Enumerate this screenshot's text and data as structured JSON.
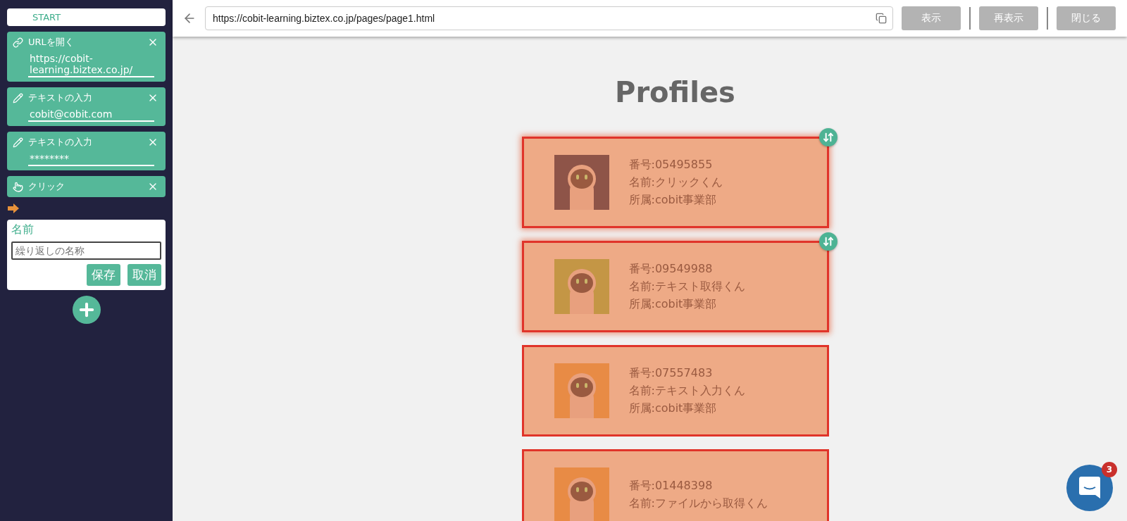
{
  "sidebar": {
    "start": "START",
    "steps": [
      {
        "kind": "url",
        "title": "URLを開く",
        "value": "https://cobit-learning.biztex.co.jp/"
      },
      {
        "kind": "text",
        "title": "テキストの入力",
        "value": "cobit@cobit.com"
      },
      {
        "kind": "text",
        "title": "テキストの入力",
        "value": "********"
      },
      {
        "kind": "click",
        "title": "クリック"
      }
    ],
    "form": {
      "label": "名前",
      "placeholder": "繰り返しの名称",
      "buttons": [
        "保存",
        "取消"
      ]
    }
  },
  "toolbar": {
    "url": "https://cobit-learning.biztex.co.jp/pages/page1.html",
    "buttons": [
      "表示",
      "再表示",
      "閉じる"
    ]
  },
  "page": {
    "title": "Profiles",
    "cards": [
      {
        "selected": true,
        "color": "#8e5448",
        "lines": [
          "番号:05495855",
          "名前:クリックくん",
          "所属:cobit事業部"
        ]
      },
      {
        "selected": true,
        "color": "#c49645",
        "lines": [
          "番号:09549988",
          "名前:テキスト取得くん",
          "所属:cobit事業部"
        ]
      },
      {
        "selected": false,
        "color": "#e88b45",
        "lines": [
          "番号:07557483",
          "名前:テキスト入力くん",
          "所属:cobit事業部"
        ]
      },
      {
        "selected": false,
        "color": "#e88b45",
        "lines": [
          "番号:01448398",
          "名前:ファイルから取得くん"
        ]
      }
    ]
  },
  "chat": {
    "badge": "3"
  }
}
